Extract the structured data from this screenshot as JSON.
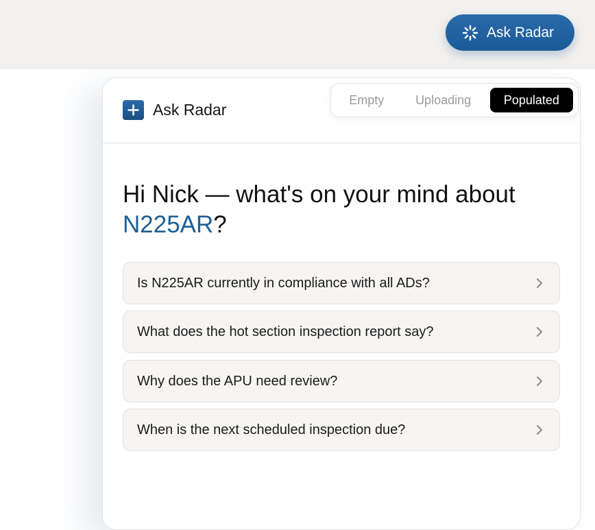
{
  "trigger": {
    "label": "Ask Radar",
    "icon": "loading-spinner-icon"
  },
  "panel": {
    "title": "Ask Radar",
    "brand_icon": "plus-icon",
    "accent_color": "#1d5f94"
  },
  "state_switcher": {
    "tabs": [
      "Empty",
      "Uploading",
      "Populated"
    ],
    "active": "Populated"
  },
  "greeting": {
    "prefix": "Hi Nick — what's on your mind about",
    "tail_number": "N225AR",
    "suffix": "?"
  },
  "suggestions": [
    "Is N225AR currently in compliance with all ADs?",
    "What does the hot section inspection report say?",
    "Why does the APU need review?",
    "When is the next scheduled inspection due?"
  ]
}
